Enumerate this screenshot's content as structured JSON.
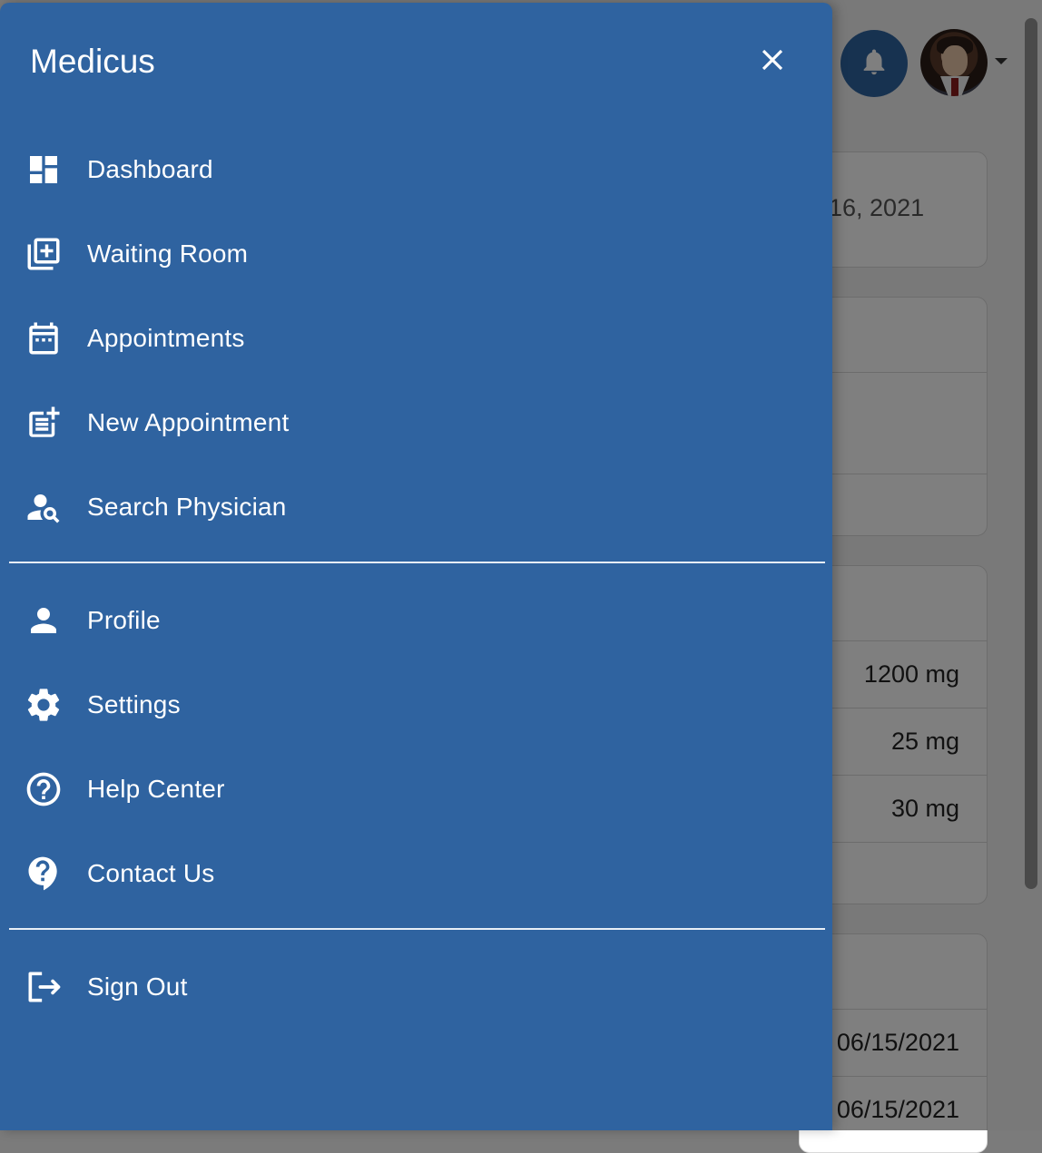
{
  "app": {
    "title": "Medicus"
  },
  "drawer": {
    "close_label": "Close",
    "sections": [
      [
        {
          "label": "Dashboard",
          "icon": "dashboard-icon"
        },
        {
          "label": "Waiting Room",
          "icon": "add-to-queue-icon"
        },
        {
          "label": "Appointments",
          "icon": "calendar-icon"
        },
        {
          "label": "New Appointment",
          "icon": "post-add-icon"
        },
        {
          "label": "Search Physician",
          "icon": "person-search-icon"
        }
      ],
      [
        {
          "label": "Profile",
          "icon": "person-icon"
        },
        {
          "label": "Settings",
          "icon": "gear-icon"
        },
        {
          "label": "Help Center",
          "icon": "help-circle-icon"
        },
        {
          "label": "Contact Us",
          "icon": "contact-support-icon"
        }
      ],
      [
        {
          "label": "Sign Out",
          "icon": "logout-icon"
        }
      ]
    ]
  },
  "background": {
    "date_fragment": "16, 2021",
    "medications": {
      "dose_1": "1200 mg",
      "dose_2": "25 mg",
      "dose_3": "30 mg"
    },
    "dates": {
      "date_1": "06/15/2021",
      "date_2": "06/15/2021"
    }
  },
  "colors": {
    "drawer": "#2f63a0",
    "accent": "#2f64a0",
    "text": "#ffffff"
  }
}
